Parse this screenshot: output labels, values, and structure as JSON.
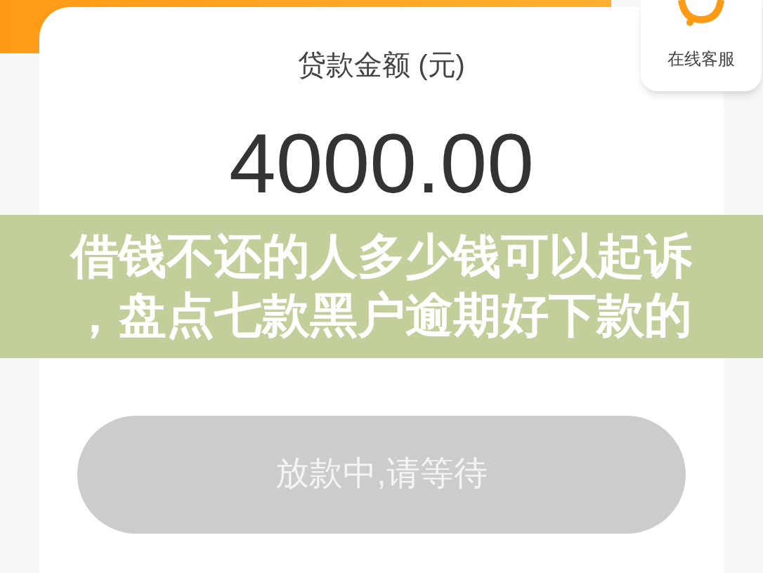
{
  "card": {
    "label": "贷款金额 (元)",
    "amount": "4000.00"
  },
  "service": {
    "label": "在线客服"
  },
  "submit_button": {
    "label": "放款中,请等待",
    "disabled": true
  },
  "banner": {
    "title": "借钱不还的人多少钱可以起诉，盘点七款黑户逾期好下款的"
  }
}
